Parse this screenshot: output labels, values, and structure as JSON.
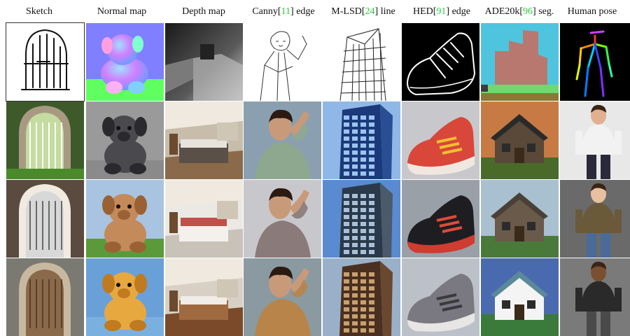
{
  "figure": {
    "columns": [
      {
        "label": "Sketch",
        "cite": "",
        "suffix": ""
      },
      {
        "label": "Normal map",
        "cite": "",
        "suffix": ""
      },
      {
        "label": "Depth map",
        "cite": "",
        "suffix": ""
      },
      {
        "label": "Canny[",
        "cite": "11",
        "suffix": "] edge"
      },
      {
        "label": "M-LSD[",
        "cite": "24",
        "suffix": "] line"
      },
      {
        "label": "HED[",
        "cite": "91",
        "suffix": "] edge"
      },
      {
        "label": "ADE20k[",
        "cite": "96",
        "suffix": "] seg."
      },
      {
        "label": "Human pose",
        "cite": "",
        "suffix": ""
      }
    ],
    "rows": 4,
    "colors": {
      "cite": "#2ecc40",
      "normal_bg": "#7f7fff",
      "hed_bg": "#000000",
      "seg_sky": "#4fc4df",
      "seg_house": "#b87870",
      "seg_grass": "#6fd86f",
      "seg_ground": "#8a7a30"
    },
    "tile_subjects": [
      [
        "sketch-arch-window",
        "normal-map-teddy",
        "depth-map-room",
        "canny-man",
        "mlsd-building",
        "hed-sneaker",
        "ade-seg-house",
        "pose-skeleton"
      ],
      [
        "garden-arch-gate",
        "gray-teddy",
        "bedroom-interior",
        "man-green-shirt",
        "glass-tower",
        "red-sneaker",
        "stone-cottage",
        "woman-white-blazer"
      ],
      [
        "arched-window",
        "tan-teddy",
        "white-bedroom",
        "man-gray-shirt",
        "office-tower",
        "black-sneaker",
        "old-stone-house",
        "boy-walking"
      ],
      [
        "wooden-arched-door",
        "yellow-teddy",
        "wood-bedroom",
        "man-brown-shirt",
        "brick-tower",
        "gray-sneaker",
        "modern-house",
        "man-in-coat"
      ]
    ]
  }
}
